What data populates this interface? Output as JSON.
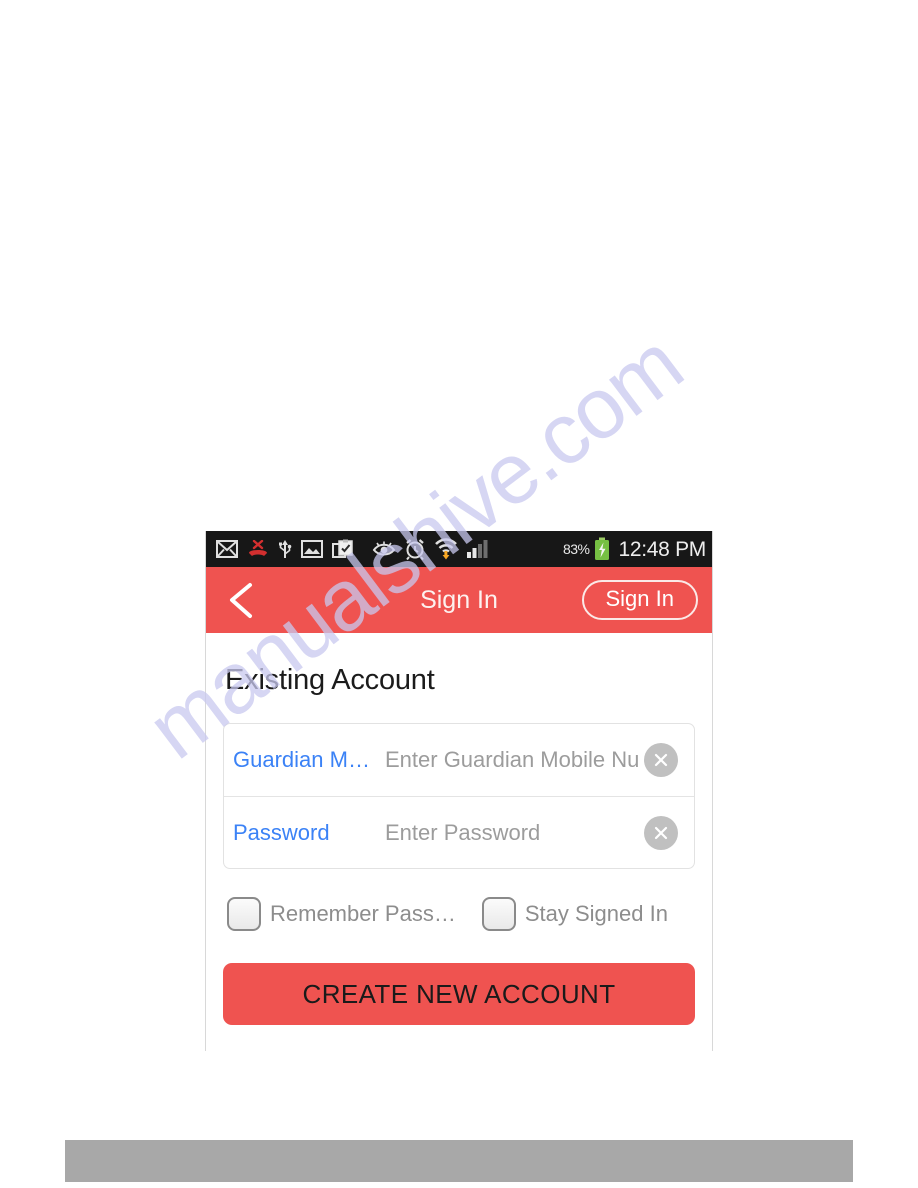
{
  "page": {
    "background_color": "#ffffff",
    "watermark_text": "manualshive.com",
    "watermark_color": "#c9c9ef"
  },
  "footer": {
    "bar_color": "#a8a8a8"
  },
  "screenshot": {
    "status_bar": {
      "background_color": "#171717",
      "icons": [
        "envelope-icon",
        "missed-call-icon",
        "usb-icon",
        "image-icon",
        "clipboard-check-icon",
        "eye-icon",
        "alarm-clock-icon",
        "wifi-download-icon",
        "signal-bars-icon"
      ],
      "battery_percent": "83%",
      "battery_state": "charging",
      "time": "12:48 PM"
    },
    "header": {
      "background_color": "#ef5350",
      "back_icon": "chevron-left-icon",
      "title": "Sign In",
      "action_button_label": "Sign In"
    },
    "main": {
      "section_heading": "Existing Account",
      "fields": [
        {
          "label": "Guardian M…",
          "placeholder": "Enter Guardian Mobile Num",
          "value": "",
          "label_color": "#3b82f6",
          "clear_icon": "clear-circle-x-icon"
        },
        {
          "label": "Password",
          "placeholder": "Enter Password",
          "value": "",
          "label_color": "#3b82f6",
          "clear_icon": "clear-circle-x-icon"
        }
      ],
      "checkboxes": [
        {
          "label": "Remember Pass…",
          "checked": false
        },
        {
          "label": "Stay Signed In",
          "checked": false
        }
      ],
      "primary_button": {
        "label": "CREATE NEW ACCOUNT",
        "background_color": "#ef5350",
        "text_color": "#1a1a1a"
      }
    }
  }
}
